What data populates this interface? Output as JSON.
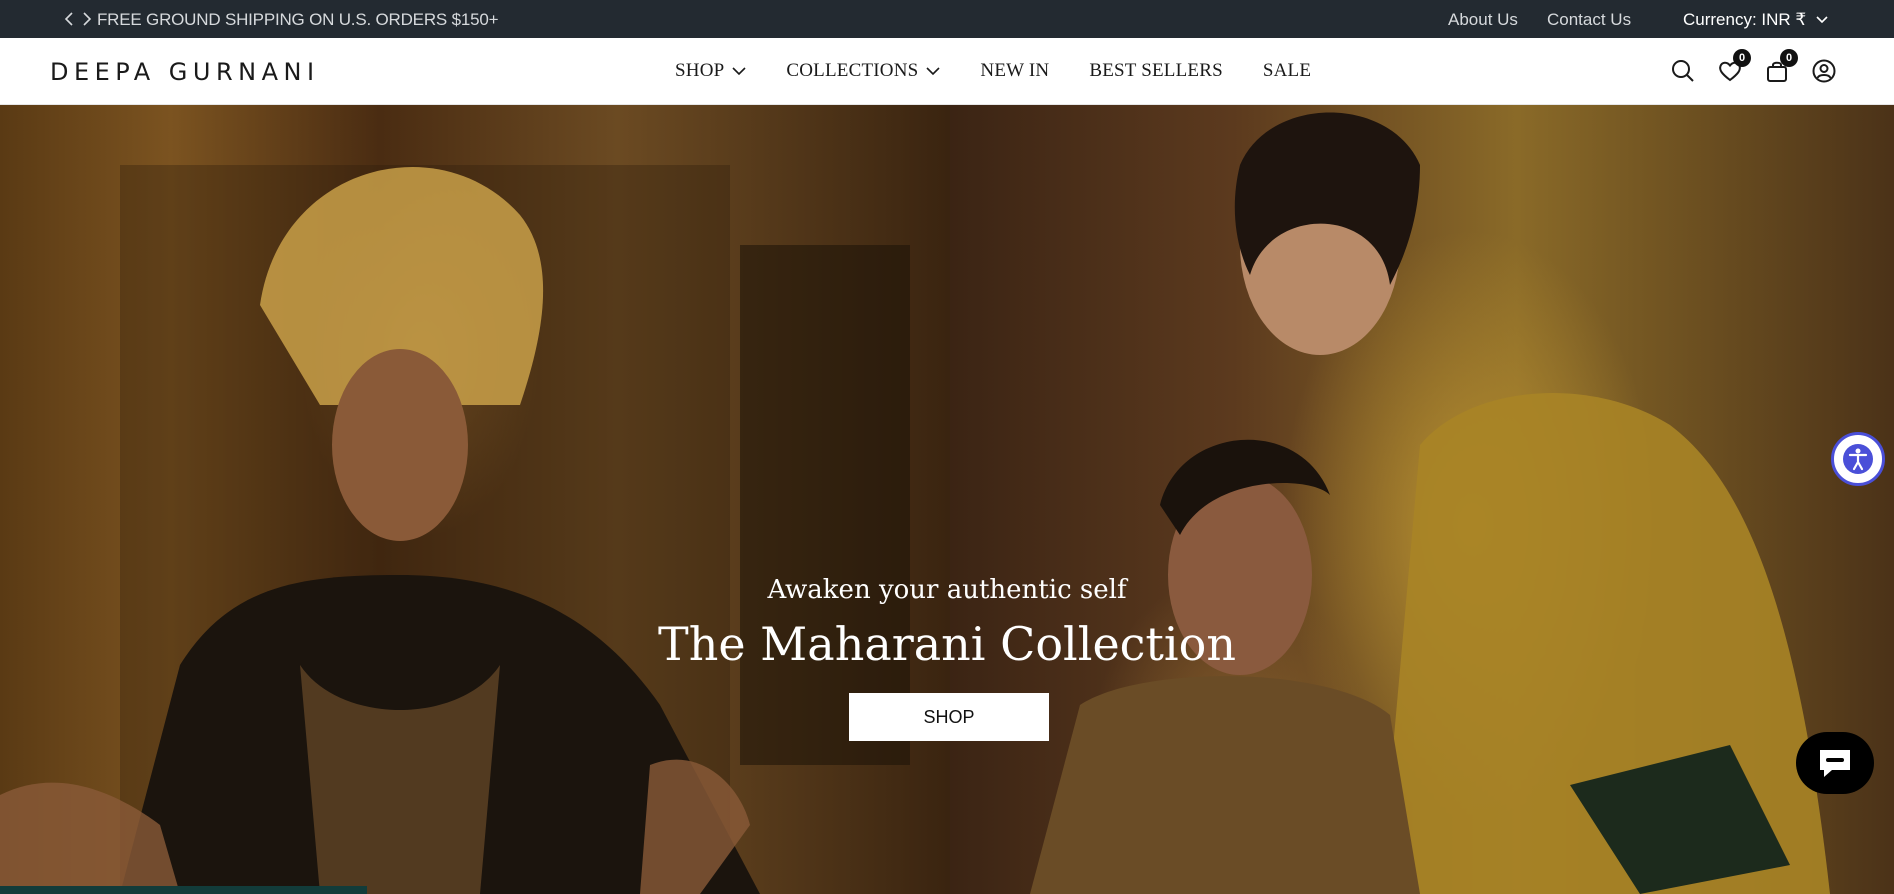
{
  "announcement": {
    "text": "FREE GROUND SHIPPING ON U.S. ORDERS $150+",
    "links": {
      "about": "About Us",
      "contact": "Contact Us"
    },
    "currency": "Currency: INR ₹"
  },
  "header": {
    "logo": "DEEPA GURNANI",
    "nav": [
      {
        "label": "SHOP",
        "has_dropdown": true
      },
      {
        "label": "COLLECTIONS",
        "has_dropdown": true
      },
      {
        "label": "NEW IN",
        "has_dropdown": false
      },
      {
        "label": "BEST SELLERS",
        "has_dropdown": false
      },
      {
        "label": "SALE",
        "has_dropdown": false
      }
    ],
    "icons": [
      "search-icon",
      "wishlist-heart-icon",
      "cart-bag-icon",
      "account-user-icon"
    ],
    "wishlist_count": "0",
    "cart_count": "0"
  },
  "hero": {
    "subtitle": "Awaken your authentic self",
    "title": "The Maharani Collection",
    "button_label": "SHOP"
  },
  "widgets": {
    "accessibility_icon": "accessibility-icon",
    "chat_icon": "chat-bubble-icon"
  },
  "colors": {
    "topbar_bg": "#232a31",
    "accent_blue": "#4a4fd8",
    "strip": "#123c3a"
  }
}
